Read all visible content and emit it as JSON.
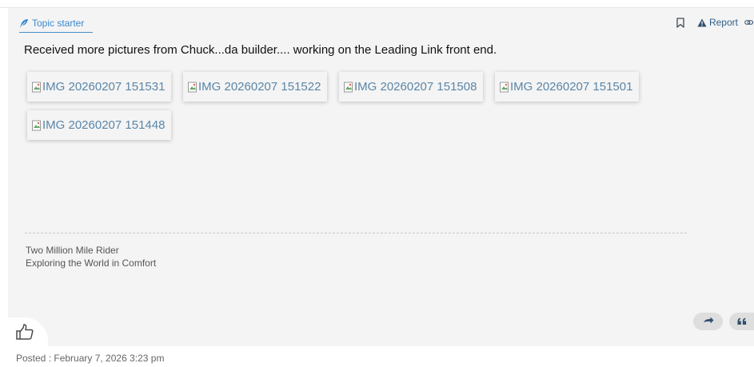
{
  "post": {
    "badge": {
      "label": "Topic starter",
      "icon": "feather-icon",
      "color": "#3a8ad0"
    },
    "actions": {
      "bookmark_icon": "bookmark-icon",
      "report_label": "Report",
      "report_icon": "warning-triangle-icon",
      "link_icon": "link-icon"
    },
    "text": "Received more pictures from Chuck...da builder.... working on the Leading Link front end.",
    "images": [
      {
        "alt": "IMG 20260207 151531"
      },
      {
        "alt": "IMG 20260207 151522"
      },
      {
        "alt": "IMG 20260207 151508"
      },
      {
        "alt": "IMG 20260207 151501"
      },
      {
        "alt": "IMG 20260207 151448"
      }
    ],
    "signature": {
      "line1": "Two Million Mile Rider",
      "line2": "Exploring the World in Comfort"
    },
    "reply_icon": "reply-arrow-icon",
    "quote_icon": "quote-icon",
    "like_icon": "thumbs-up-icon",
    "posted": "Posted : February 7, 2026 3:23 pm"
  }
}
